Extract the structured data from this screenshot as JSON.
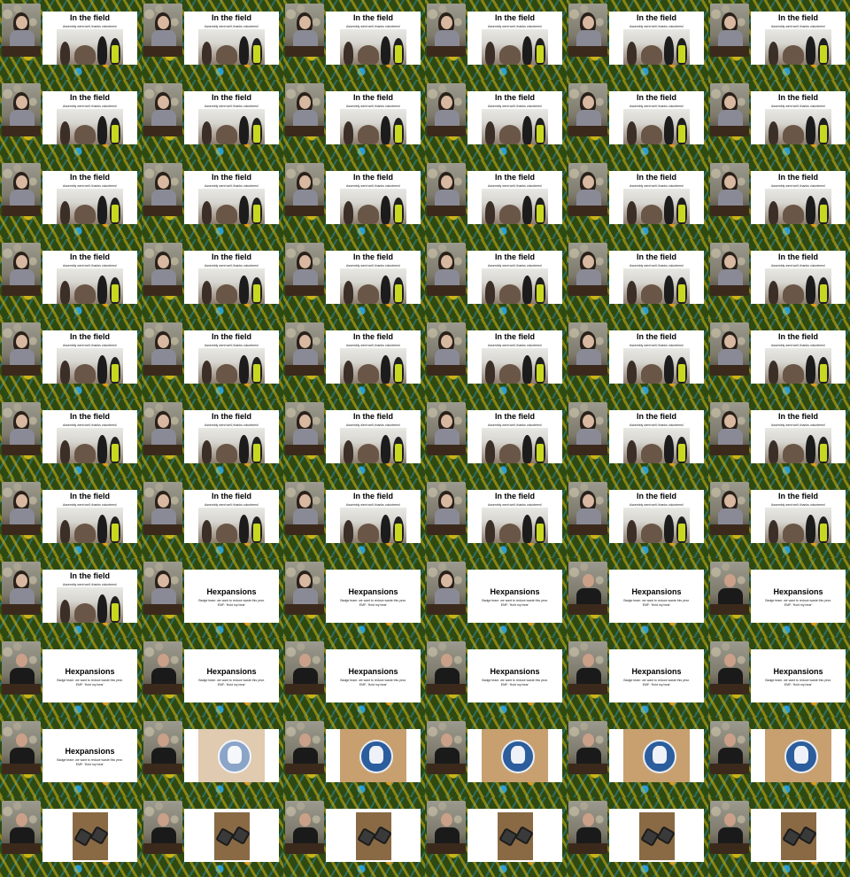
{
  "slides": {
    "field": {
      "title": "In the field",
      "subtitle": "Assembly went well; thanks volunteers!"
    },
    "hex": {
      "title": "Hexpansions",
      "line1": "Badge team: we want to reduce waste this year.",
      "line2": "EMF: 'Hold my bear'"
    }
  },
  "colors": {
    "background_base": "#2e4a12",
    "pattern_yellow": "#c8b418",
    "pattern_blue": "#2aa0d8",
    "pattern_orange": "#e08a1a",
    "slide_background": "#ffffff",
    "badge_blue": "#2c5d9c"
  },
  "speakers": [
    "woman-dark-hair",
    "man-black-tshirt"
  ],
  "grid": {
    "columns": 6,
    "rows": 11,
    "cells": [
      {
        "slide": "field",
        "speaker": 0
      },
      {
        "slide": "field",
        "speaker": 0
      },
      {
        "slide": "field",
        "speaker": 0
      },
      {
        "slide": "field",
        "speaker": 0
      },
      {
        "slide": "field",
        "speaker": 0
      },
      {
        "slide": "field",
        "speaker": 0
      },
      {
        "slide": "field",
        "speaker": 0
      },
      {
        "slide": "field",
        "speaker": 0
      },
      {
        "slide": "field",
        "speaker": 0
      },
      {
        "slide": "field",
        "speaker": 0
      },
      {
        "slide": "field",
        "speaker": 0
      },
      {
        "slide": "field",
        "speaker": 0
      },
      {
        "slide": "field",
        "speaker": 0
      },
      {
        "slide": "field",
        "speaker": 0
      },
      {
        "slide": "field",
        "speaker": 0
      },
      {
        "slide": "field",
        "speaker": 0
      },
      {
        "slide": "field",
        "speaker": 0
      },
      {
        "slide": "field",
        "speaker": 0
      },
      {
        "slide": "field",
        "speaker": 0
      },
      {
        "slide": "field",
        "speaker": 0
      },
      {
        "slide": "field",
        "speaker": 0
      },
      {
        "slide": "field",
        "speaker": 0
      },
      {
        "slide": "field",
        "speaker": 0
      },
      {
        "slide": "field",
        "speaker": 0
      },
      {
        "slide": "field",
        "speaker": 0
      },
      {
        "slide": "field",
        "speaker": 0
      },
      {
        "slide": "field",
        "speaker": 0
      },
      {
        "slide": "field",
        "speaker": 0
      },
      {
        "slide": "field",
        "speaker": 0
      },
      {
        "slide": "field",
        "speaker": 0
      },
      {
        "slide": "field",
        "speaker": 0
      },
      {
        "slide": "field",
        "speaker": 0
      },
      {
        "slide": "field",
        "speaker": 0
      },
      {
        "slide": "field",
        "speaker": 0
      },
      {
        "slide": "field",
        "speaker": 0
      },
      {
        "slide": "field",
        "speaker": 0
      },
      {
        "slide": "field",
        "speaker": 0
      },
      {
        "slide": "field",
        "speaker": 0
      },
      {
        "slide": "field",
        "speaker": 0
      },
      {
        "slide": "field",
        "speaker": 0
      },
      {
        "slide": "field",
        "speaker": 0
      },
      {
        "slide": "field",
        "speaker": 0
      },
      {
        "slide": "field",
        "speaker": 0
      },
      {
        "slide": "hex",
        "speaker": 0
      },
      {
        "slide": "hex",
        "speaker": 0
      },
      {
        "slide": "hex",
        "speaker": 0
      },
      {
        "slide": "hex",
        "speaker": 1
      },
      {
        "slide": "hex",
        "speaker": 1
      },
      {
        "slide": "hex",
        "speaker": 1
      },
      {
        "slide": "hex",
        "speaker": 1
      },
      {
        "slide": "hex",
        "speaker": 1
      },
      {
        "slide": "hex",
        "speaker": 1
      },
      {
        "slide": "hex",
        "speaker": 1
      },
      {
        "slide": "hex",
        "speaker": 1
      },
      {
        "slide": "hex",
        "speaker": 1
      },
      {
        "slide": "badge_faded",
        "speaker": 1
      },
      {
        "slide": "badge",
        "speaker": 1
      },
      {
        "slide": "badge",
        "speaker": 1
      },
      {
        "slide": "badge",
        "speaker": 1
      },
      {
        "slide": "badge",
        "speaker": 1
      },
      {
        "slide": "pcb",
        "speaker": 1
      },
      {
        "slide": "pcb",
        "speaker": 1
      },
      {
        "slide": "pcb",
        "speaker": 1
      },
      {
        "slide": "pcb",
        "speaker": 1
      },
      {
        "slide": "pcb",
        "speaker": 1
      },
      {
        "slide": "pcb",
        "speaker": 1
      }
    ]
  }
}
